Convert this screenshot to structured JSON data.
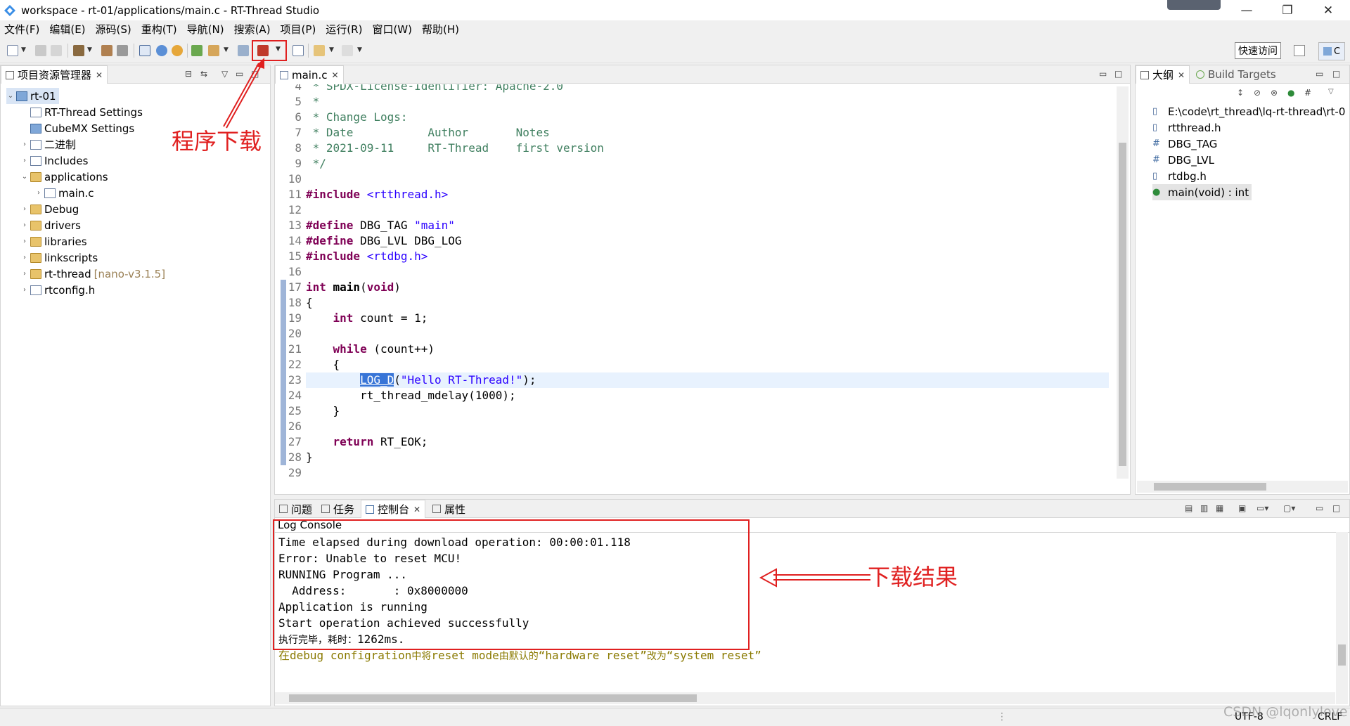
{
  "window": {
    "title": "workspace - rt-01/applications/main.c - RT-Thread Studio",
    "controls": [
      "—",
      "❐",
      "✕"
    ]
  },
  "menu": [
    "文件(F)",
    "编辑(E)",
    "源码(S)",
    "重构(T)",
    "导航(N)",
    "搜索(A)",
    "项目(P)",
    "运行(R)",
    "窗口(W)",
    "帮助(H)"
  ],
  "toolbar": {
    "quick_access": "快速访问",
    "perspective": "C"
  },
  "explorer": {
    "tab": "项目资源管理器",
    "tree": [
      {
        "label": "rt-01",
        "twisty": "⌄",
        "icon": "project-icon"
      },
      {
        "label": "RT-Thread Settings",
        "twisty": "",
        "icon": "rt-settings-icon"
      },
      {
        "label": "CubeMX Settings",
        "twisty": "",
        "icon": "cubemx-icon"
      },
      {
        "label": "二进制",
        "twisty": "›",
        "icon": "binaries-icon"
      },
      {
        "label": "Includes",
        "twisty": "›",
        "icon": "includes-icon"
      },
      {
        "label": "applications",
        "twisty": "⌄",
        "icon": "folder-icon"
      },
      {
        "label": "main.c",
        "twisty": "›",
        "icon": "c-file-icon"
      },
      {
        "label": "Debug",
        "twisty": "›",
        "icon": "folder-icon"
      },
      {
        "label": "drivers",
        "twisty": "›",
        "icon": "folder-icon"
      },
      {
        "label": "libraries",
        "twisty": "›",
        "icon": "folder-icon"
      },
      {
        "label": "linkscripts",
        "twisty": "›",
        "icon": "folder-icon"
      },
      {
        "label": "rt-thread",
        "twisty": "›",
        "icon": "folder-icon",
        "suffix": "[nano-v3.1.5]"
      },
      {
        "label": "rtconfig.h",
        "twisty": "›",
        "icon": "h-file-icon"
      }
    ]
  },
  "annotations": {
    "download_label": "程序下载",
    "result_label": "下载结果"
  },
  "editor": {
    "tab": "main.c",
    "lines": [
      {
        "n": "4",
        "parts": [
          [
            "cm",
            " * SPDX-License-Identifier: Apache-2.0"
          ]
        ]
      },
      {
        "n": "5",
        "parts": [
          [
            "cm",
            " *"
          ]
        ]
      },
      {
        "n": "6",
        "parts": [
          [
            "cm",
            " * Change Logs:"
          ]
        ]
      },
      {
        "n": "7",
        "parts": [
          [
            "cm",
            " * Date           Author       Notes"
          ]
        ]
      },
      {
        "n": "8",
        "parts": [
          [
            "cm",
            " * 2021-09-11     RT-Thread    first version"
          ]
        ]
      },
      {
        "n": "9",
        "parts": [
          [
            "cm",
            " */"
          ]
        ]
      },
      {
        "n": "10",
        "parts": []
      },
      {
        "n": "11",
        "parts": [
          [
            "kw",
            "#include "
          ],
          [
            "str",
            "<rtthread.h>"
          ]
        ]
      },
      {
        "n": "12",
        "parts": []
      },
      {
        "n": "13",
        "parts": [
          [
            "kw",
            "#define "
          ],
          [
            "",
            "DBG_TAG "
          ],
          [
            "str",
            "\"main\""
          ]
        ]
      },
      {
        "n": "14",
        "parts": [
          [
            "kw",
            "#define "
          ],
          [
            "",
            "DBG_LVL DBG_LOG"
          ]
        ]
      },
      {
        "n": "15",
        "parts": [
          [
            "kw",
            "#include "
          ],
          [
            "str",
            "<rtdbg.h>"
          ]
        ]
      },
      {
        "n": "16",
        "parts": []
      },
      {
        "n": "17",
        "parts": [
          [
            "kw",
            "int "
          ],
          [
            "b",
            "main"
          ],
          [
            "",
            "("
          ],
          [
            "kw",
            "void"
          ],
          [
            "",
            ")"
          ]
        ]
      },
      {
        "n": "18",
        "parts": [
          [
            "",
            "{"
          ]
        ]
      },
      {
        "n": "19",
        "parts": [
          [
            "",
            "    "
          ],
          [
            "kw",
            "int "
          ],
          [
            "",
            "count = 1;"
          ]
        ]
      },
      {
        "n": "20",
        "parts": []
      },
      {
        "n": "21",
        "parts": [
          [
            "",
            "    "
          ],
          [
            "kw",
            "while "
          ],
          [
            "",
            "(count++)"
          ]
        ]
      },
      {
        "n": "22",
        "parts": [
          [
            "",
            "    {"
          ]
        ]
      },
      {
        "n": "23",
        "parts": [
          [
            "",
            "        "
          ],
          [
            "sel",
            "LOG_D"
          ],
          [
            "",
            "("
          ],
          [
            "str",
            "\"Hello RT-Thread!\""
          ],
          [
            "",
            ");"
          ]
        ]
      },
      {
        "n": "24",
        "parts": [
          [
            "",
            "        rt_thread_mdelay(1000);"
          ]
        ]
      },
      {
        "n": "25",
        "parts": [
          [
            "",
            "    }"
          ]
        ]
      },
      {
        "n": "26",
        "parts": []
      },
      {
        "n": "27",
        "parts": [
          [
            "",
            "    "
          ],
          [
            "kw",
            "return "
          ],
          [
            "",
            "RT_EOK;"
          ]
        ]
      },
      {
        "n": "28",
        "parts": [
          [
            "",
            "}"
          ]
        ]
      },
      {
        "n": "29",
        "parts": []
      }
    ]
  },
  "outline": {
    "tab_outline": "大纲",
    "tab_build": "Build Targets",
    "items": [
      {
        "label": "E:\\code\\rt_thread\\lq-rt-thread\\rt-0",
        "icon": "include-icon"
      },
      {
        "label": "rtthread.h",
        "icon": "include-icon"
      },
      {
        "label": "DBG_TAG",
        "icon": "macro-icon"
      },
      {
        "label": "DBG_LVL",
        "icon": "macro-icon"
      },
      {
        "label": "rtdbg.h",
        "icon": "include-icon"
      },
      {
        "label": "main(void) : int",
        "icon": "function-icon"
      }
    ]
  },
  "console": {
    "tabs": [
      "问题",
      "任务",
      "控制台",
      "属性"
    ],
    "header": "Log Console",
    "lines": [
      "Time elapsed during download operation: 00:00:01.118",
      "Error: Unable to reset MCU!",
      "RUNNING Program ...",
      "  Address:       : 0x8000000",
      "Application is running",
      "Start operation achieved successfully"
    ],
    "done_prefix": "执行完毕，耗时：",
    "done_value": "1262ms.",
    "note_parts": [
      [
        "mono",
        "在"
      ],
      [
        "mono",
        "debug configration"
      ],
      [
        "zh",
        "中将"
      ],
      [
        "mono",
        "reset mode"
      ],
      [
        "zh",
        "由默认的"
      ],
      [
        "mono",
        "“hardware reset”"
      ],
      [
        "zh",
        "改为"
      ],
      [
        "mono",
        "“system reset”"
      ]
    ]
  },
  "status": {
    "encoding": "UTF-8",
    "line_ending": "CRLF",
    "watermark": "CSDN @lqonlylove"
  },
  "colors": {
    "annotation_red": "#e02020",
    "keyword": "#7f0055",
    "string": "#2a00ff",
    "comment": "#3f7f5f",
    "note_olive": "#8a7a00"
  }
}
